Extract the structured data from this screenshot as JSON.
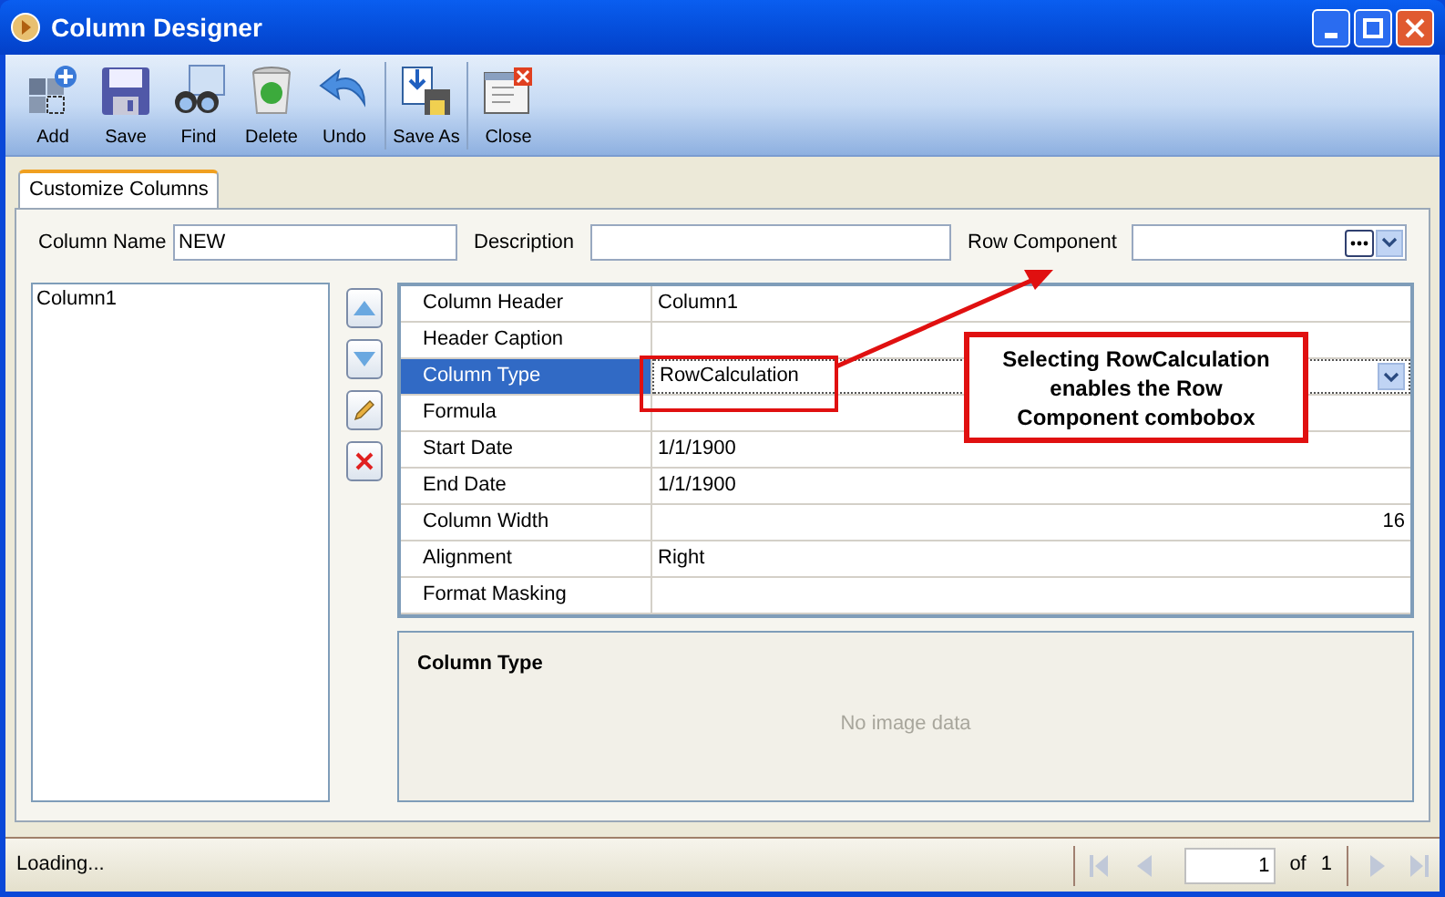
{
  "window": {
    "title": "Column Designer"
  },
  "toolbar": {
    "groups": [
      {
        "buttons": [
          {
            "label": "Add",
            "kind": "add"
          },
          {
            "label": "Save",
            "kind": "save"
          },
          {
            "label": "Find",
            "kind": "find"
          },
          {
            "label": "Delete",
            "kind": "delete"
          },
          {
            "label": "Undo",
            "kind": "undo"
          }
        ]
      },
      {
        "buttons": [
          {
            "label": "Save As",
            "kind": "saveas"
          }
        ]
      },
      {
        "buttons": [
          {
            "label": "Close",
            "kind": "close"
          }
        ]
      }
    ]
  },
  "tabs": [
    {
      "label": "Customize Columns",
      "selected": true
    }
  ],
  "fields": [
    {
      "label": "Column Name",
      "value": "NEW",
      "kind": "text"
    },
    {
      "label": "Description",
      "kind": "text"
    },
    {
      "label": "Row Component",
      "kind": "combo"
    }
  ],
  "column_list": [
    {
      "label": "Column1",
      "selected": false
    }
  ],
  "side_buttons": [
    {
      "kind": "up"
    },
    {
      "kind": "down"
    },
    {
      "kind": "edit"
    },
    {
      "kind": "delete"
    }
  ],
  "properties": [
    {
      "name": "Column Header",
      "value": "Column1",
      "kind": "text",
      "selected": false
    },
    {
      "name": "Header Caption",
      "kind": "text",
      "selected": false
    },
    {
      "name": "Column Type",
      "value": "RowCalculation",
      "kind": "combo",
      "selected": true
    },
    {
      "name": "Formula",
      "kind": "text",
      "selected": false
    },
    {
      "name": "Start Date",
      "value": "1/1/1900",
      "kind": "text",
      "selected": false
    },
    {
      "name": "End Date",
      "value": "1/1/1900",
      "kind": "text",
      "selected": false
    },
    {
      "name": "Column Width",
      "value": "16",
      "kind": "number",
      "selected": false
    },
    {
      "name": "Alignment",
      "value": "Right",
      "kind": "text",
      "selected": false
    },
    {
      "name": "Format Masking",
      "kind": "text",
      "selected": false
    }
  ],
  "description_panel": {
    "title": "Column Type",
    "placeholder": "No image data"
  },
  "annotation": {
    "text": "Selecting RowCalculation enables the Row Component combobox"
  },
  "status_bar": {
    "text": "Loading...",
    "pager": {
      "page": "1",
      "of_label": "of",
      "total": "1"
    }
  }
}
